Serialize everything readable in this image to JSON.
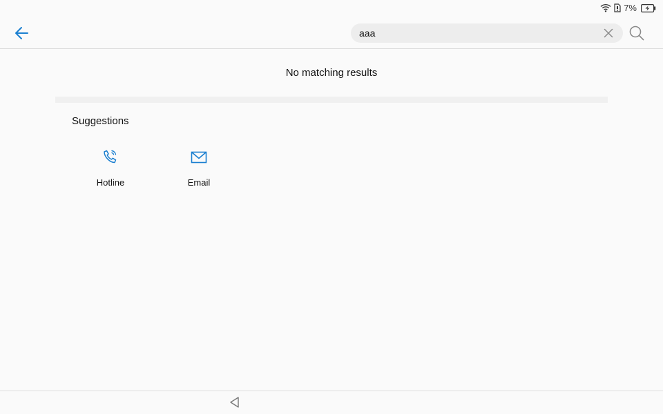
{
  "status_bar": {
    "battery_percent": "7%",
    "icons": [
      "wifi-icon",
      "sim-icon",
      "battery-charging-icon"
    ]
  },
  "app_bar": {
    "back_icon": "arrow-left-icon",
    "search": {
      "value": "aaa",
      "placeholder": ""
    },
    "clear_icon": "close-icon",
    "search_icon": "search-icon"
  },
  "main": {
    "no_results_text": "No matching results",
    "suggestions_title": "Suggestions",
    "suggestions": [
      {
        "label": "Hotline",
        "icon": "phone-call-icon"
      },
      {
        "label": "Email",
        "icon": "mail-icon"
      }
    ]
  },
  "nav_bar": {
    "back_icon": "triangle-back-icon"
  },
  "colors": {
    "accent": "#1a7fd0",
    "background": "#fafafa",
    "search_bg": "#ededed",
    "divider": "#dcdcdc"
  }
}
